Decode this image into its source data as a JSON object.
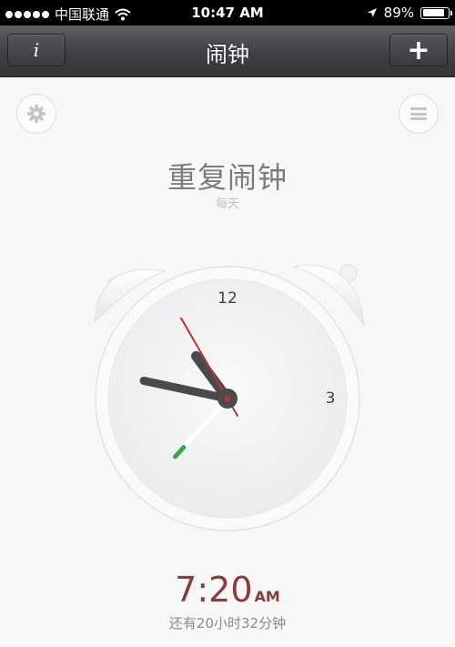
{
  "status_bar": {
    "carrier": "中国联通",
    "time": "10:47 AM",
    "battery_percent": "89%",
    "battery_level": 0.89,
    "icons": [
      "signal-dots-icon",
      "wifi-icon",
      "location-arrow-icon",
      "battery-icon"
    ]
  },
  "nav": {
    "title": "闹钟",
    "info_label": "i",
    "add_label": "+"
  },
  "toolbar": {
    "settings_icon": "gear-icon",
    "menu_icon": "hamburger-menu-icon"
  },
  "alarm": {
    "title": "重复闹钟",
    "repeat": "每天",
    "time": "7:20",
    "ampm": "AM",
    "countdown": "还有20小时32分钟"
  },
  "clock": {
    "label_12": "12",
    "label_3": "3",
    "hour": 10,
    "minute": 47,
    "second_hand_minute": 55,
    "alarm_hand_minute": 37,
    "colors": {
      "face": "#f4f4f5",
      "hands": "#4a4a4c",
      "second_hand": "#b73535",
      "alarm_hand_tip": "#3fa34d"
    }
  }
}
